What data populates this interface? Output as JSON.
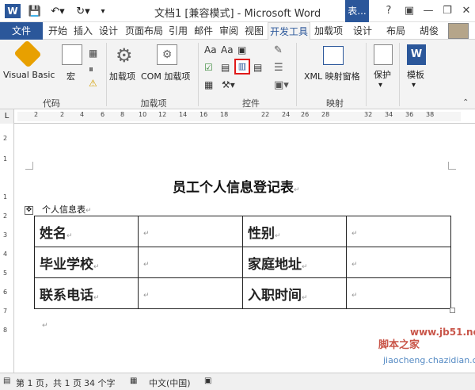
{
  "window": {
    "title": "文档1 [兼容模式] - Microsoft Word",
    "context_tab": "表...",
    "help": "?",
    "minimize": "—",
    "restore": "❐",
    "close": "✕"
  },
  "tabs": {
    "file": "文件",
    "items": [
      "开始",
      "插入",
      "设计",
      "页面布局",
      "引用",
      "邮件",
      "审阅",
      "视图",
      "开发工具",
      "加载项",
      "设计",
      "布局"
    ],
    "active": "开发工具",
    "user": "胡俊"
  },
  "ribbon": {
    "code_group": {
      "label": "代码",
      "vb": "Visual Basic",
      "macro": "宏"
    },
    "addins_group": {
      "label": "加载项",
      "addins": "加载项",
      "com_addins": "COM 加载项"
    },
    "controls_group": {
      "label": "控件"
    },
    "mapping_group": {
      "label": "映射",
      "xml_pane": "XML 映射窗格"
    },
    "protect": {
      "label": "保护"
    },
    "template": {
      "label": "模板"
    }
  },
  "ruler": {
    "corner": "L",
    "ticks": [
      "2",
      "2",
      "4",
      "6",
      "8",
      "10",
      "12",
      "14",
      "16",
      "18",
      "22",
      "24",
      "26",
      "28",
      "32",
      "34",
      "36",
      "38"
    ],
    "vticks": [
      "2",
      "1",
      "1",
      "2",
      "3",
      "4",
      "5",
      "6",
      "7",
      "8"
    ]
  },
  "document": {
    "title": "员工个人信息登记表",
    "caption": "个人信息表",
    "table": [
      [
        "姓名",
        "",
        "性别",
        ""
      ],
      [
        "毕业学校",
        "",
        "家庭地址",
        ""
      ],
      [
        "联系电话",
        "",
        "入职时间",
        ""
      ]
    ],
    "para_mark": "↵"
  },
  "status": {
    "page": "第 1 页，共 1 页",
    "words": "34 个字",
    "language": "中文(中国)"
  },
  "watermark": {
    "line1": "脚本之家",
    "line2": "jiaocheng.chazidian.com",
    "site": "www.jb51.net"
  },
  "colors": {
    "brand": "#2b579a",
    "highlight": "#e01b1b"
  }
}
